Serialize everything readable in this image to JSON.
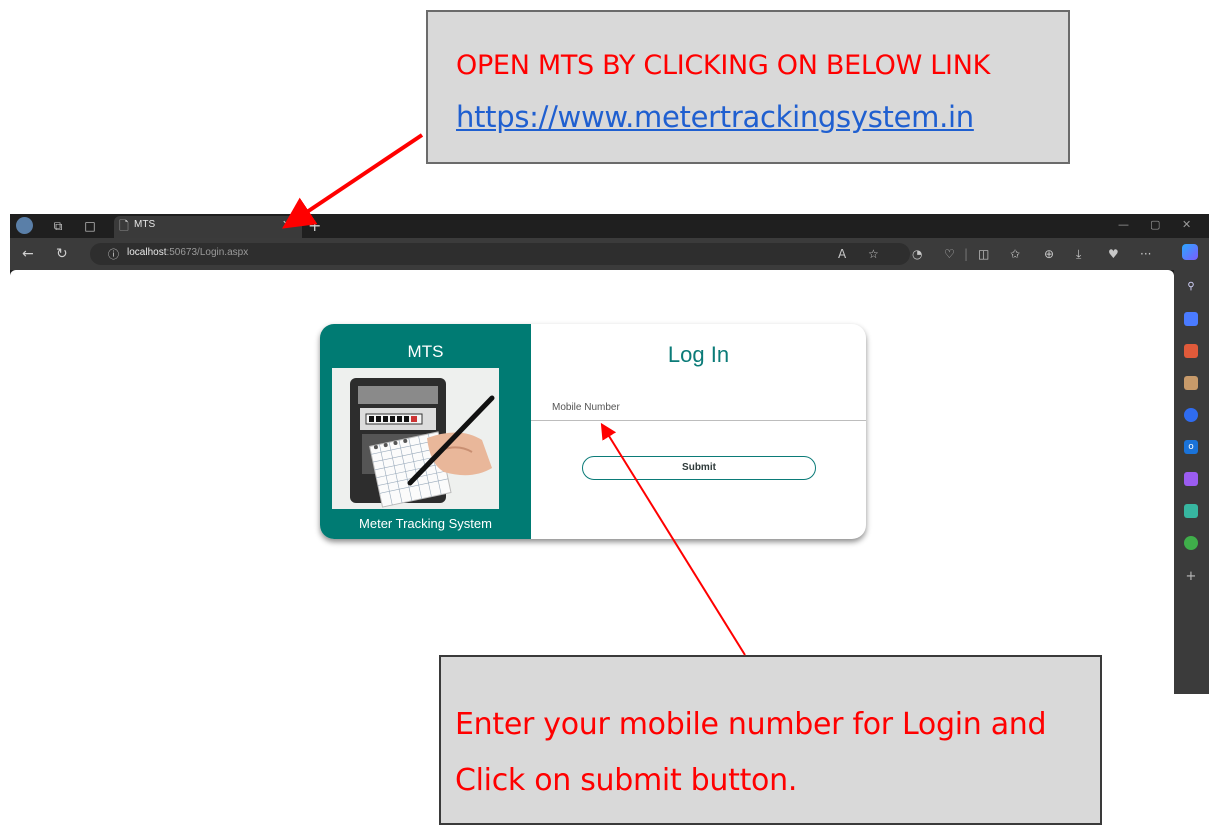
{
  "callouts": {
    "top": {
      "line1": "OPEN MTS BY CLICKING ON BELOW LINK",
      "link": "https://www.metertrackingsystem.in"
    },
    "bottom": {
      "line1": "Enter your mobile number for Login and",
      "line2": "Click on submit button."
    }
  },
  "browser": {
    "tab_title": "MTS",
    "url_host": "localhost",
    "url_rest": ":50673/Login.aspx",
    "icons": [
      "profile-icon",
      "workspaces-icon",
      "tab-actions-icon",
      "page-icon",
      "close-icon",
      "new-tab-icon",
      "minimize-icon",
      "restore-icon",
      "window-close-icon",
      "back-icon",
      "refresh-icon",
      "info-icon",
      "read-aloud-icon",
      "favorite-icon",
      "extension-icon",
      "browser-essentials-icon",
      "split-screen-icon",
      "favorites-icon",
      "collections-icon",
      "downloads-icon",
      "performance-icon",
      "more-icon",
      "copilot-icon"
    ],
    "side_icons": [
      "search-icon",
      "shopping-icon",
      "tools-icon",
      "games-icon",
      "microsoft365-icon",
      "outlook-icon",
      "designer-icon",
      "drop-icon",
      "tree-icon",
      "add-icon"
    ]
  },
  "login": {
    "brand": "MTS",
    "tagline": "Meter Tracking System",
    "title": "Log In",
    "mobile_label": "Mobile Number",
    "submit_label": "Submit"
  },
  "colors": {
    "accent": "#007b73",
    "callout_text": "#ff0000",
    "link": "#1f5fd0",
    "callout_bg": "#d9d9d9"
  }
}
